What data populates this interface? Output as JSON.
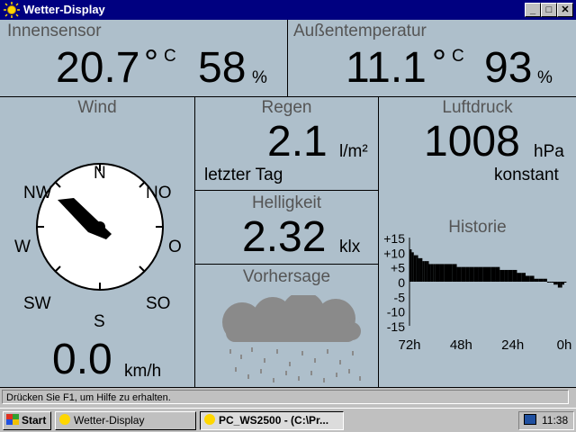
{
  "window": {
    "title": "Wetter-Display",
    "buttons": {
      "minimize": "_",
      "maximize": "□",
      "close": "✕"
    }
  },
  "indoor": {
    "label": "Innensensor",
    "temperature": "20.7",
    "temp_unit": "°C",
    "humidity": "58",
    "humidity_unit": "%"
  },
  "outdoor": {
    "label": "Außentemperatur",
    "temperature": "11.1",
    "temp_unit": "°C",
    "humidity": "93",
    "humidity_unit": "%"
  },
  "wind": {
    "label": "Wind",
    "speed": "0.0",
    "unit": "km/h",
    "compass": {
      "n": "N",
      "no": "NO",
      "o": "O",
      "so": "SO",
      "s": "S",
      "sw": "SW",
      "w": "W",
      "nw": "NW"
    },
    "direction": "NW"
  },
  "rain": {
    "label": "Regen",
    "value": "2.1",
    "unit": "l/m²",
    "period": "letzter Tag"
  },
  "brightness": {
    "label": "Helligkeit",
    "value": "2.32",
    "unit": "klx"
  },
  "forecast": {
    "label": "Vorhersage",
    "icon": "rain-cloud-icon"
  },
  "pressure": {
    "label": "Luftdruck",
    "value": "1008",
    "unit": "hPa",
    "trend": "konstant"
  },
  "chart_data": {
    "type": "bar",
    "title": "Historie",
    "ylim": [
      -15,
      15
    ],
    "y_ticks": [
      "+15",
      "+10",
      "+5",
      "0",
      "-5",
      "-10",
      "-15"
    ],
    "x_ticks": [
      "72h",
      "48h",
      "24h",
      "0h"
    ],
    "xlim": [
      72,
      0
    ],
    "series": [
      {
        "x": [
          72,
          71,
          70,
          69,
          68,
          67,
          66,
          65,
          64,
          63,
          62,
          61,
          60,
          58,
          56,
          54,
          52,
          50,
          48,
          46,
          44,
          42,
          40,
          38,
          36,
          34,
          32,
          30,
          28,
          26,
          24,
          22,
          20,
          18,
          16,
          14,
          12,
          10,
          8,
          7,
          6,
          5,
          4,
          3,
          2,
          1,
          0
        ],
        "values": [
          11,
          10,
          9,
          9,
          8,
          8,
          7,
          7,
          7,
          6,
          6,
          6,
          6,
          6,
          6,
          6,
          6,
          5,
          5,
          5,
          5,
          5,
          5,
          5,
          5,
          5,
          5,
          4,
          4,
          4,
          4,
          3,
          3,
          2,
          2,
          1,
          1,
          1,
          0,
          0,
          0,
          -1,
          -1,
          -2,
          -2,
          -1,
          0
        ]
      }
    ]
  },
  "statusbar": {
    "text": "Drücken Sie F1, um Hilfe zu erhalten."
  },
  "taskbar": {
    "start": "Start",
    "tasks": [
      "Wetter-Display",
      "PC_WS2500 - (C:\\Pr..."
    ],
    "clock": "11:38"
  }
}
